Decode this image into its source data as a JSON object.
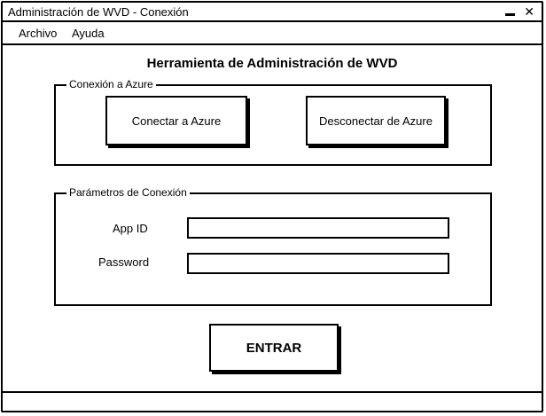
{
  "window": {
    "title": "Administración de WVD - Conexión",
    "minimize_glyph": "▁",
    "close_glyph": "✕"
  },
  "menu": {
    "items": [
      {
        "label": "Archivo"
      },
      {
        "label": "Ayuda"
      }
    ]
  },
  "main": {
    "heading": "Herramienta de Administración de WVD",
    "azure_group": {
      "legend": "Conexión a Azure",
      "connect_label": "Conectar a Azure",
      "disconnect_label": "Desconectar de Azure"
    },
    "params_group": {
      "legend": "Parámetros de Conexión",
      "app_id_label": "App ID",
      "app_id_value": "",
      "password_label": "Password",
      "password_value": ""
    },
    "enter_label": "ENTRAR"
  },
  "icons": {
    "minimize": "minimize-icon",
    "close": "close-icon"
  }
}
